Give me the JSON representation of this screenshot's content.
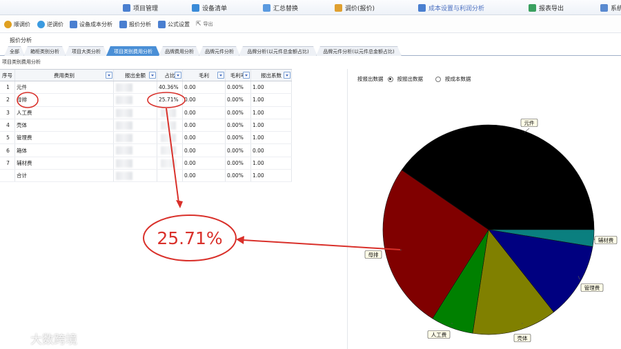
{
  "menu": [
    {
      "label": "项目管理",
      "color": "#4a7fd0"
    },
    {
      "label": "设备清单",
      "color": "#3a8bd8"
    },
    {
      "label": "汇总替换",
      "color": "#5a9ae0"
    },
    {
      "label": "调价(报价)",
      "color": "#e0a030"
    },
    {
      "label": "成本设置与利润分析",
      "color": "#4a7fd0"
    },
    {
      "label": "报表导出",
      "color": "#3aa060"
    },
    {
      "label": "系统",
      "color": "#5a8ad0"
    }
  ],
  "toolbar": [
    {
      "label": "顺调价",
      "color": "#e0a020"
    },
    {
      "label": "逆调价",
      "color": "#3a9ae0"
    },
    {
      "label": "设备成本分析",
      "color": "#4a7fd0"
    },
    {
      "label": "报价分析",
      "color": "#4a7fd0"
    },
    {
      "label": "公式设置",
      "color": "#4a7fd0"
    },
    {
      "label": "导出",
      "color": "#888888"
    }
  ],
  "section_title": "报价分析",
  "tabs": [
    "全部",
    "箱柜类别分析",
    "项目大类分析",
    "项目类别费用分析",
    "品牌费用分析",
    "品牌元件分析",
    "品牌分析(以元件总金额占比)",
    "品牌元件分析(以元件总金额占比)"
  ],
  "active_tab": 3,
  "subtitle": "项目类别费用分析",
  "table": {
    "headers": [
      "序号",
      "费用类别",
      "报出金额",
      "占比",
      "毛利",
      "毛利率",
      "报出系数"
    ],
    "rows": [
      {
        "no": "1",
        "cat": "元件",
        "pct": "40.36%",
        "profit": "0.00",
        "rate": "0.00%",
        "coef": "1.00"
      },
      {
        "no": "2",
        "cat": "母排",
        "pct": "25.71%",
        "profit": "0.00",
        "rate": "0.00%",
        "coef": "1.00"
      },
      {
        "no": "3",
        "cat": "人工费",
        "pct": "",
        "profit": "0.00",
        "rate": "0.00%",
        "coef": "1.00"
      },
      {
        "no": "4",
        "cat": "壳体",
        "pct": "",
        "profit": "0.00",
        "rate": "0.00%",
        "coef": "1.00"
      },
      {
        "no": "5",
        "cat": "管理费",
        "pct": "",
        "profit": "0.00",
        "rate": "0.00%",
        "coef": "1.00"
      },
      {
        "no": "6",
        "cat": "箱体",
        "pct": "",
        "profit": "0.00",
        "rate": "0.00%",
        "coef": "0.00"
      },
      {
        "no": "7",
        "cat": "辅材费",
        "pct": "",
        "profit": "0.00",
        "rate": "0.00%",
        "coef": "1.00"
      },
      {
        "no": "",
        "cat": "合计",
        "pct": "",
        "profit": "0.00",
        "rate": "0.00%",
        "coef": "1.00"
      }
    ]
  },
  "chart_panel": {
    "label": "按报出数据",
    "options": [
      "按报出数据",
      "按成本数据"
    ],
    "selected": 0
  },
  "chart_data": {
    "type": "pie",
    "slices": [
      {
        "name": "元件",
        "value": 40.36,
        "color": "#000000"
      },
      {
        "name": "辅材费",
        "value": 2.6,
        "color": "#0a7f7f"
      },
      {
        "name": "管理费",
        "value": 11.8,
        "color": "#000080"
      },
      {
        "name": "壳体",
        "value": 13.0,
        "color": "#808000"
      },
      {
        "name": "人工费",
        "value": 6.5,
        "color": "#008000"
      },
      {
        "name": "母排",
        "value": 25.71,
        "color": "#800000"
      }
    ]
  },
  "callout": {
    "text": "25.71%",
    "color": "#d9302a"
  },
  "watermark": "大数跨境"
}
